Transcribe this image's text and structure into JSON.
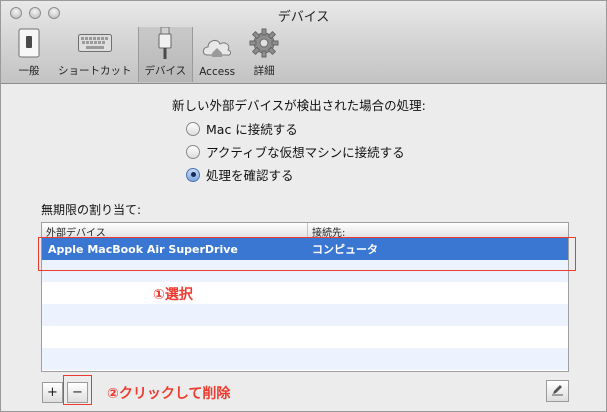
{
  "window": {
    "title": "デバイス"
  },
  "toolbar": {
    "items": [
      {
        "label": "一般",
        "icon": "switch-icon"
      },
      {
        "label": "ショートカット",
        "icon": "keyboard-icon"
      },
      {
        "label": "デバイス",
        "icon": "usb-cable-icon",
        "selected": true
      },
      {
        "label": "Access",
        "icon": "cloud-house-icon"
      },
      {
        "label": "詳細",
        "icon": "gear-icon"
      }
    ]
  },
  "connection": {
    "question": "新しい外部デバイスが検出された場合の処理:",
    "options": [
      {
        "label": "Mac に接続する",
        "checked": false
      },
      {
        "label": "アクティブな仮想マシンに接続する",
        "checked": false
      },
      {
        "label": "処理を確認する",
        "checked": true
      }
    ]
  },
  "devices": {
    "section_label": "無期限の割り当て:",
    "columns": [
      "外部デバイス",
      "接続先:"
    ],
    "rows": [
      {
        "device": "Apple MacBook Air SuperDrive",
        "target": "コンピュータ",
        "selected": true
      }
    ]
  },
  "annotations": {
    "select": "①選択",
    "delete": "②クリックして削除"
  },
  "buttons": {
    "add": "+",
    "remove": "−"
  },
  "colors": {
    "selection": "#3a77d2",
    "annotation": "#ee3b2f"
  }
}
